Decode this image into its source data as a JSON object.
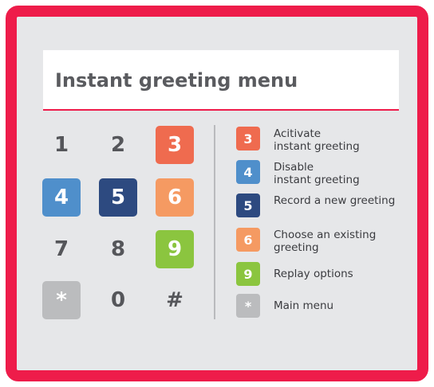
{
  "title": "Instant greeting menu",
  "keypad": [
    {
      "label": "1",
      "color": null
    },
    {
      "label": "2",
      "color": null
    },
    {
      "label": "3",
      "color": "#ef6b4f"
    },
    {
      "label": "4",
      "color": "#4f8fcb"
    },
    {
      "label": "5",
      "color": "#2d4a80"
    },
    {
      "label": "6",
      "color": "#f59a62"
    },
    {
      "label": "7",
      "color": null
    },
    {
      "label": "8",
      "color": null
    },
    {
      "label": "9",
      "color": "#8bc53f"
    },
    {
      "label": "*",
      "color": "#bbbcbe"
    },
    {
      "label": "0",
      "color": null
    },
    {
      "label": "#",
      "color": null
    }
  ],
  "legend": [
    {
      "key": "3",
      "color": "#ef6b4f",
      "text": "Acitivate\ninstant greeting"
    },
    {
      "key": "4",
      "color": "#4f8fcb",
      "text": "Disable\ninstant greeting"
    },
    {
      "key": "5",
      "color": "#2d4a80",
      "text": "Record a new greeting"
    },
    {
      "key": "6",
      "color": "#f59a62",
      "text": "Choose an existing\ngreeting"
    },
    {
      "key": "9",
      "color": "#8bc53f",
      "text": "Replay options"
    },
    {
      "key": "*",
      "color": "#bbbcbe",
      "text": "Main menu"
    }
  ]
}
